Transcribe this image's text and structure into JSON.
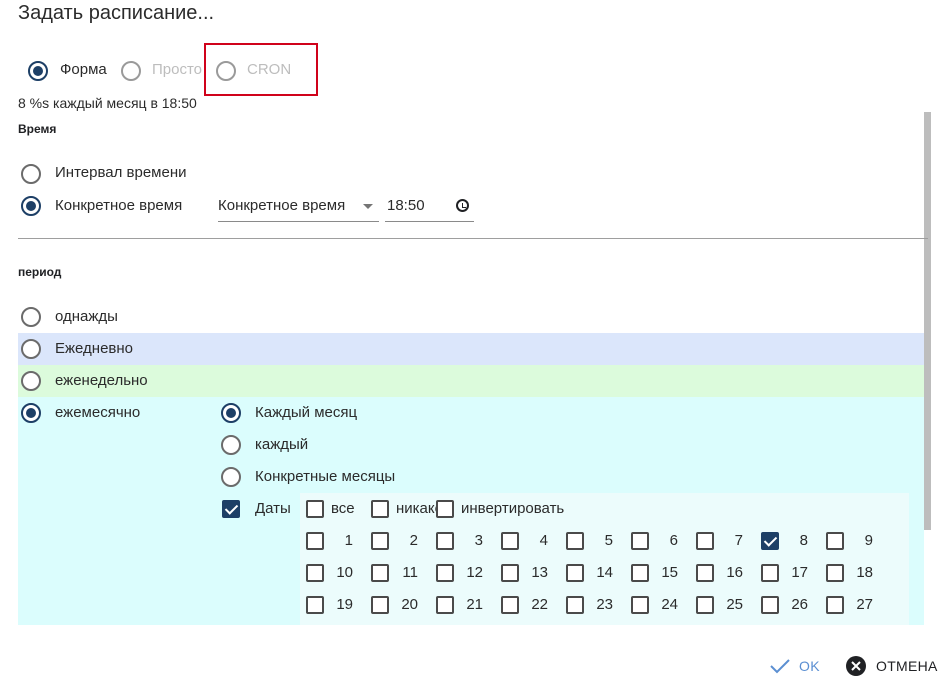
{
  "dialog": {
    "title": "Задать расписание..."
  },
  "mode": {
    "options": [
      {
        "label": "Форма",
        "selected": true
      },
      {
        "label": "Просто",
        "selected": false
      },
      {
        "label": "CRON",
        "selected": false
      }
    ]
  },
  "summary": "8 %s каждый месяц в 18:50",
  "time": {
    "section_label": "Время",
    "interval_label": "Интервал времени",
    "specific_label": "Конкретное время",
    "select_value": "Конкретное время",
    "time_value": "18:50"
  },
  "period": {
    "section_label": "период",
    "once": "однажды",
    "daily": "Ежедневно",
    "weekly": "еженедельно",
    "monthly": "ежемесячно",
    "monthly_opts": {
      "every_month": "Каждый месяц",
      "every": "каждый",
      "specific_months": "Конкретные месяцы",
      "dates": "Даты",
      "all": "все",
      "none": "никакой",
      "invert": "инвертировать"
    },
    "days": [
      "1",
      "2",
      "3",
      "4",
      "5",
      "6",
      "7",
      "8",
      "9",
      "10",
      "11",
      "12",
      "13",
      "14",
      "15",
      "16",
      "17",
      "18",
      "19",
      "20",
      "21",
      "22",
      "23",
      "24",
      "25",
      "26",
      "27"
    ],
    "checked_day": "8"
  },
  "colors": {
    "daily_bg": "#dbe6fb",
    "weekly_bg": "#dcfbdc",
    "monthly_bg": "#dbfdfd",
    "dates_bg": "#ecfcfc",
    "accent": "#1d3f66",
    "ok_color": "#5b8fd2"
  },
  "actions": {
    "ok": "OK",
    "cancel": "ОТМЕНА"
  }
}
